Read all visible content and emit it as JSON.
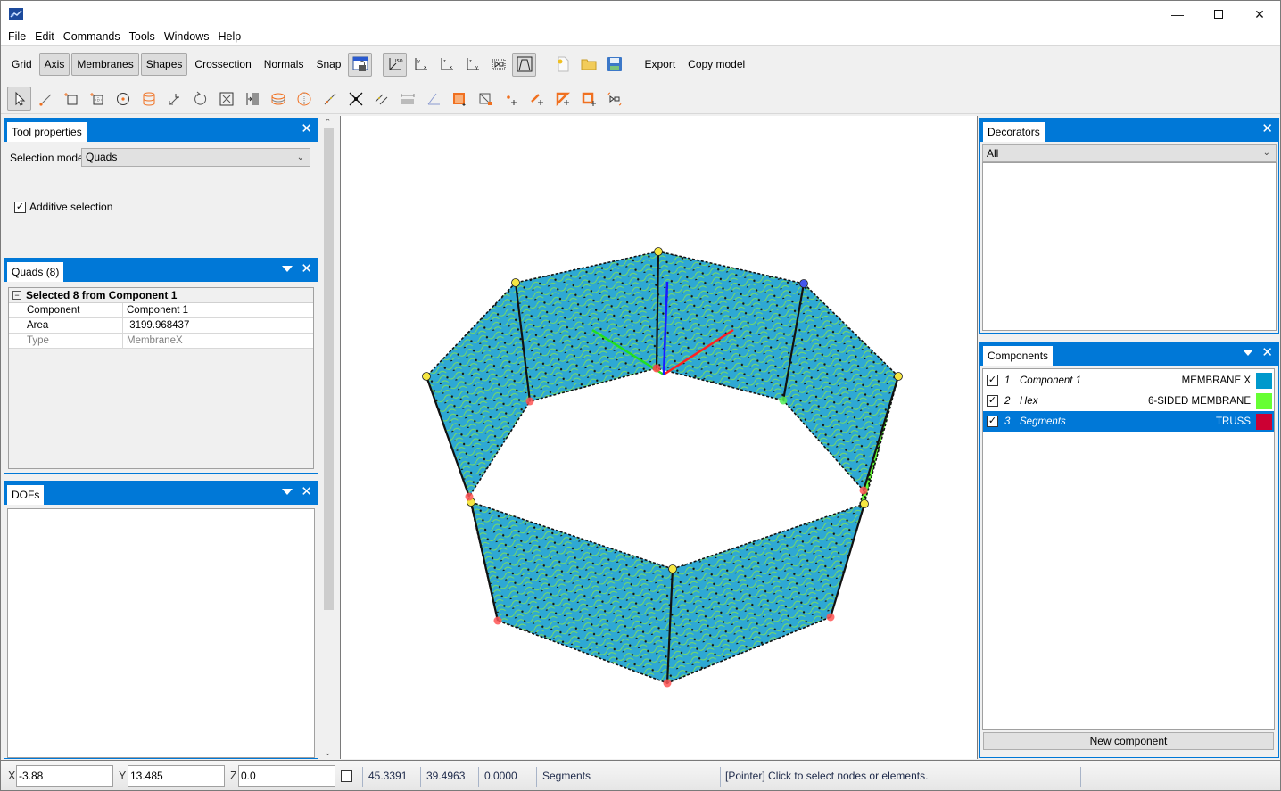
{
  "window": {
    "app_icon": "app-logo-icon",
    "controls": [
      "minimize",
      "maximize",
      "close"
    ]
  },
  "menu": [
    "File",
    "Edit",
    "Commands",
    "Tools",
    "Windows",
    "Help"
  ],
  "toolbar_top": {
    "toggles": [
      {
        "label": "Grid",
        "active": false
      },
      {
        "label": "Axis",
        "active": true
      },
      {
        "label": "Membranes",
        "active": true
      },
      {
        "label": "Shapes",
        "active": true
      },
      {
        "label": "Crossection",
        "active": false
      },
      {
        "label": "Normals",
        "active": false
      },
      {
        "label": "Snap",
        "active": false
      }
    ],
    "lock_icon": "window-lock-icon",
    "view_icons": [
      "view-iso-icon",
      "view-xy-icon",
      "view-xz-icon",
      "view-yz-icon",
      "zoom-fit-icon",
      "perspective-icon"
    ],
    "file_icons": [
      "new-file-icon",
      "open-folder-icon",
      "save-icon"
    ],
    "export_label": "Export",
    "copy_model_label": "Copy model"
  },
  "toolbar_tools": [
    "pointer-icon",
    "line-tool-icon",
    "rectangle-tool-icon",
    "grid-rect-tool-icon",
    "circle-tool-icon",
    "cylinder-tool-icon",
    "move-icon",
    "rotate-icon",
    "scale-icon",
    "array-icon",
    "ring-icon",
    "sphere-icon",
    "segment-icon",
    "intersect-icon",
    "parallel-icon",
    "dimension-icon",
    "angle-icon",
    "quad-fill-icon",
    "quad-split-icon",
    "add-node-icon",
    "add-line-icon",
    "add-triangle-icon",
    "add-quad-icon",
    "link-icon"
  ],
  "tool_properties": {
    "title": "Tool properties",
    "selection_model_label": "Selection model",
    "selection_model_value": "Quads",
    "additive_selection_label": "Additive selection",
    "additive_selection_checked": true
  },
  "quads_panel": {
    "title": "Quads (8)",
    "category": "Selected 8 from Component 1",
    "rows": [
      {
        "key": "Component",
        "value": "Component 1",
        "readonly": false
      },
      {
        "key": "Area",
        "value": " 3199.968437",
        "readonly": false
      },
      {
        "key": "Type",
        "value": "MembraneX",
        "readonly": true
      }
    ]
  },
  "dofs_panel": {
    "title": "DOFs"
  },
  "decorators_panel": {
    "title": "Decorators",
    "filter_value": "All"
  },
  "components_panel": {
    "title": "Components",
    "items": [
      {
        "index": "1",
        "name": "Component 1",
        "type": "MEMBRANE X",
        "color": "#0099cc",
        "checked": true,
        "selected": false
      },
      {
        "index": "2",
        "name": "Hex",
        "type": "6-SIDED MEMBRANE",
        "color": "#66ff33",
        "checked": true,
        "selected": false
      },
      {
        "index": "3",
        "name": "Segments",
        "type": "TRUSS",
        "color": "#cc0033",
        "checked": true,
        "selected": true
      }
    ],
    "new_button_label": "New component"
  },
  "viewport": {
    "membrane_color": "#2ea8d4",
    "mesh_line_color": "#7ddf5a",
    "axis_colors": {
      "x": "#ff2020",
      "y": "#20e020",
      "z": "#1a1aff"
    }
  },
  "status": {
    "x_label": "X",
    "x_value": "-3.88",
    "y_label": "Y",
    "y_value": "13.485",
    "z_label": "Z",
    "z_value": "0.0",
    "lock_checked": false,
    "readout_1": "45.3391",
    "readout_2": "39.4963",
    "readout_3": "0.0000",
    "active_component": "Segments",
    "message": "[Pointer] Click to select nodes or elements."
  }
}
